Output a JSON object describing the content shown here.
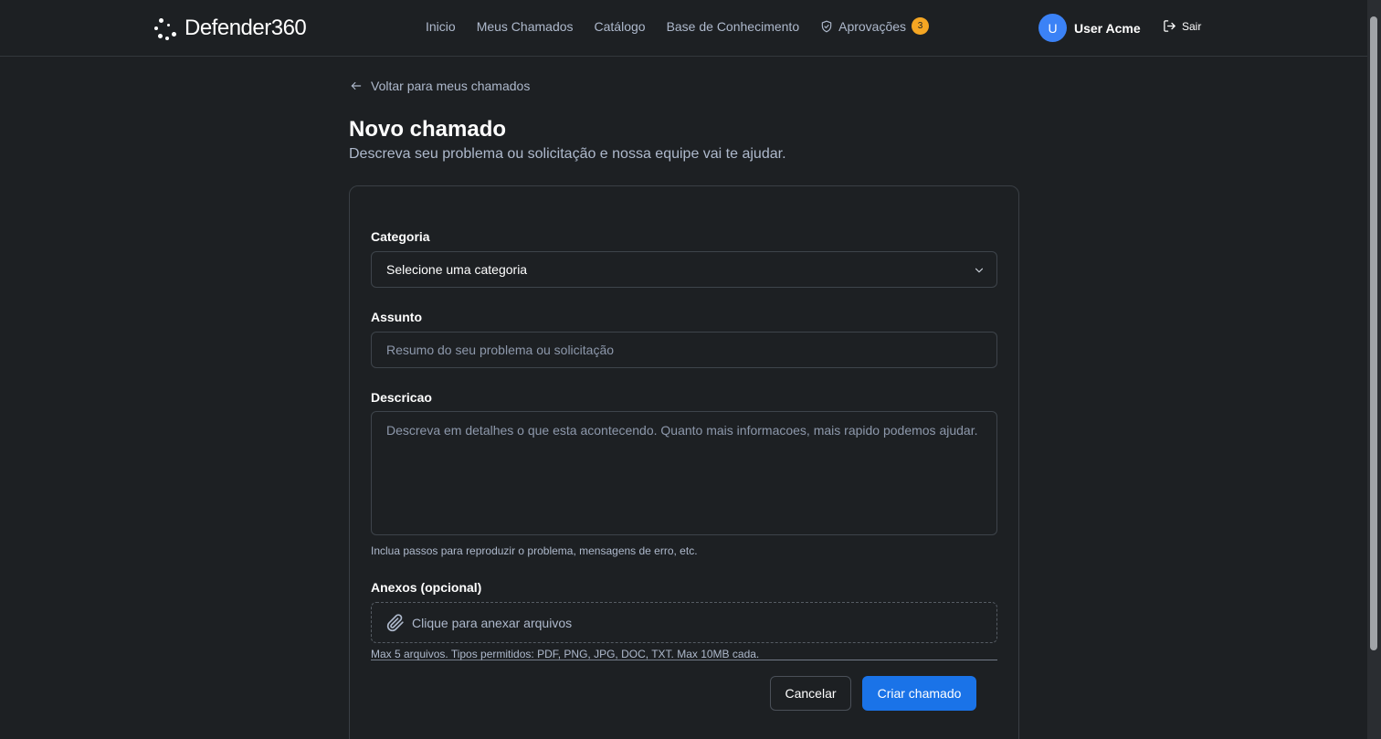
{
  "header": {
    "logo_text": "Defender360",
    "nav": [
      {
        "label": "Inicio"
      },
      {
        "label": "Meus Chamados"
      },
      {
        "label": "Catálogo"
      },
      {
        "label": "Base de Conhecimento"
      },
      {
        "label": "Aprovações",
        "badge": "3",
        "icon": "shield-icon"
      }
    ],
    "user": {
      "initial": "U",
      "name": "User Acme"
    },
    "logout_label": "Sair"
  },
  "page": {
    "back_label": "Voltar para meus chamados",
    "title": "Novo chamado",
    "subtitle": "Descreva seu problema ou solicitação e nossa equipe vai te ajudar."
  },
  "form": {
    "category": {
      "label": "Categoria",
      "value": "Selecione uma categoria"
    },
    "subject": {
      "label": "Assunto",
      "placeholder": "Resumo do seu problema ou solicitação"
    },
    "description": {
      "label": "Descricao",
      "placeholder": "Descreva em detalhes o que esta acontecendo. Quanto mais informacoes, mais rapido podemos ajudar.",
      "hint": "Inclua passos para reproduzir o problema, mensagens de erro, etc."
    },
    "attachments": {
      "label": "Anexos (opcional)",
      "dropzone_text": "Clique para anexar arquivos",
      "hint": "Max 5 arquivos. Tipos permitidos: PDF, PNG, JPG, DOC, TXT. Max 10MB cada."
    },
    "cancel_label": "Cancelar",
    "submit_label": "Criar chamado"
  },
  "colors": {
    "background": "#1d2023",
    "accent": "#1a73e8",
    "badge": "#f5a623",
    "avatar": "#3b82f6"
  }
}
